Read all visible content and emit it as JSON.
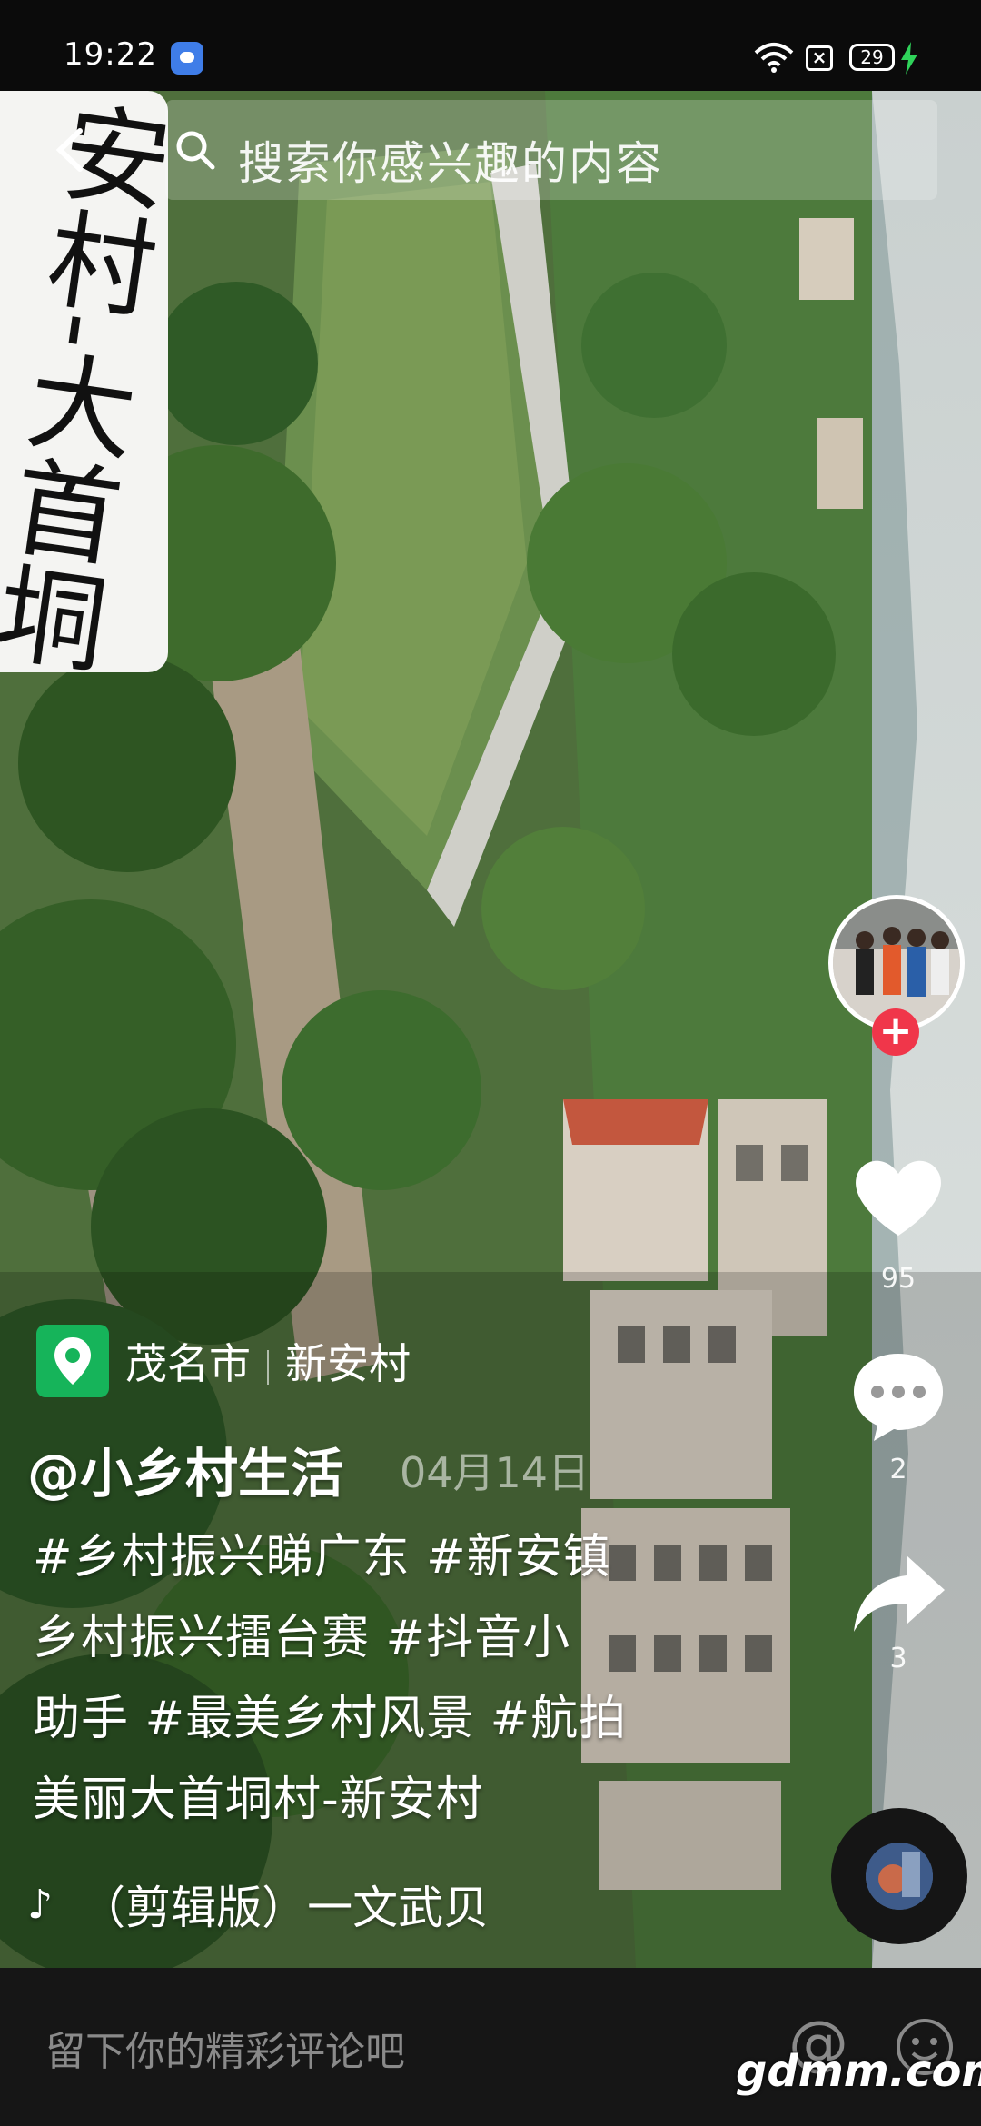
{
  "status_bar": {
    "time": "19:22",
    "battery": "29"
  },
  "search": {
    "placeholder": "搜索你感兴趣的内容"
  },
  "overlay_text": "安村-大首垌",
  "location": {
    "city": "茂名市",
    "village": "新安村"
  },
  "author": "@小乡村生活",
  "date": "04月14日",
  "description_lines": [
    "#乡村振兴睇广东 #新安镇",
    "乡村振兴擂台赛 #抖音小",
    "助手 #最美乡村风景 #航拍",
    "美丽大首垌村-新安村"
  ],
  "music": "（剪辑版）一文武贝",
  "actions": {
    "likes": "95",
    "comments": "2",
    "shares": "3",
    "follow_symbol": "+"
  },
  "comment_bar": {
    "placeholder": "留下你的精彩评论吧",
    "at_symbol": "@"
  },
  "watermark": "gdmm.com",
  "colors": {
    "location_pin": "#16b45a",
    "follow_button": "#f0364a",
    "comment_bar": "#161616"
  }
}
